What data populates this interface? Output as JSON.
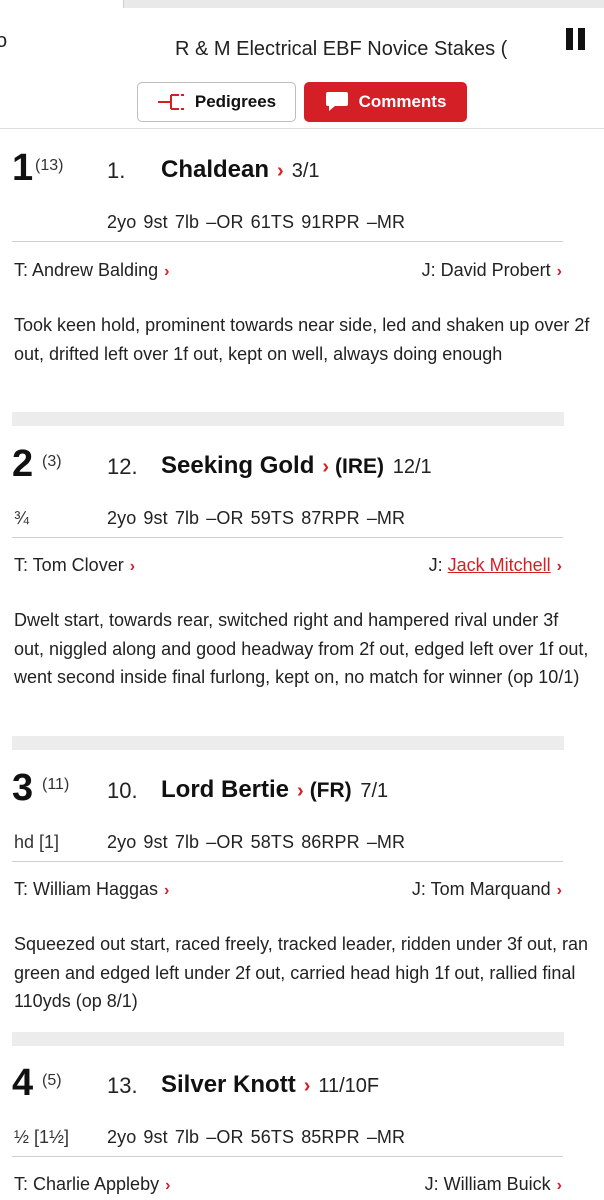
{
  "header": {
    "left_fragment": "o",
    "race_title": "R & M Electrical EBF Novice Stakes (",
    "pause_icon": "pause-icon"
  },
  "buttons": {
    "pedigrees": {
      "label": "Pedigrees",
      "icon": "pedigree-icon"
    },
    "comments": {
      "label": "Comments",
      "icon": "comment-bubble-icon"
    }
  },
  "colors": {
    "accent": "#d51f26",
    "separator": "#ececec"
  },
  "runners": [
    {
      "position": "1",
      "draw": "(13)",
      "cloth": "1.",
      "horse": "Chaldean",
      "country": "",
      "odds": "3/1",
      "distance": "",
      "stats": "2yo  9st  7lb  –OR  61TS  91RPR  –MR",
      "trainer": "T: Andrew Balding",
      "jockey": "J: David Probert",
      "jockey_link": false,
      "comment": "Took keen hold, prominent towards near side, led and shaken up over 2f out, drifted left over 1f out, kept on well, always doing enough"
    },
    {
      "position": "2",
      "draw": "(3)",
      "cloth": "12.",
      "horse": "Seeking Gold",
      "country": "(IRE)",
      "odds": "12/1",
      "distance": "¾",
      "stats": "2yo  9st  7lb  –OR  59TS  87RPR  –MR",
      "trainer": "T: Tom Clover",
      "jockey_prefix": "J: ",
      "jockey": "Jack Mitchell",
      "jockey_link": true,
      "comment": "Dwelt start, towards rear, switched right and hampered rival under 3f out, niggled along and good headway from 2f out, edged left over 1f out, went second inside final furlong, kept on, no match for winner (op 10/1)"
    },
    {
      "position": "3",
      "draw": "(11)",
      "cloth": "10.",
      "horse": "Lord Bertie",
      "country": "(FR)",
      "odds": "7/1",
      "distance": "hd [1]",
      "stats": "2yo  9st  7lb  –OR  58TS  86RPR  –MR",
      "trainer": "T: William Haggas",
      "jockey": "J: Tom Marquand",
      "jockey_link": false,
      "comment": "Squeezed out start, raced freely, tracked leader, ridden under 3f out, ran green and edged left under 2f out, carried head high 1f out, rallied final 110yds (op 8/1)"
    },
    {
      "position": "4",
      "draw": "(5)",
      "cloth": "13.",
      "horse": "Silver Knott",
      "country": "",
      "odds": "11/10F",
      "distance": "½ [1½]",
      "stats": "2yo  9st  7lb  –OR  56TS  85RPR  –MR",
      "trainer": "T: Charlie Appleby",
      "jockey": "J: William Buick",
      "jockey_link": false,
      "comment": ""
    }
  ]
}
